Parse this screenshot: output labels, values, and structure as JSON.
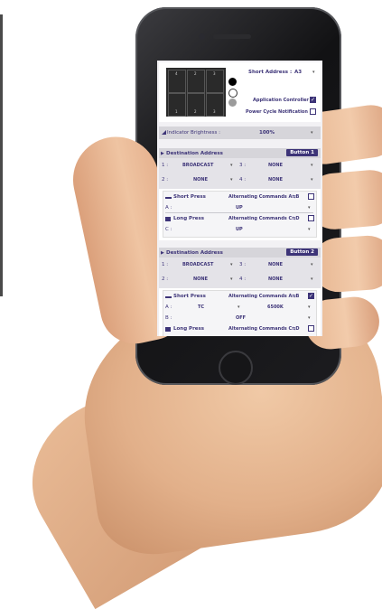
{
  "colors": {
    "accent": "#3d3478",
    "panel": "#d6d5da",
    "screen_bg": "#f2f1f4"
  },
  "top": {
    "grid_numbers": [
      "4",
      "2",
      "3",
      "1",
      "2",
      "3"
    ],
    "short_address_label": "Short Address :",
    "short_address_value": "A3",
    "application_controller_label": "Application Controller :",
    "power_cycle_label": "Power Cycle Notification :"
  },
  "brightness": {
    "label": "Indicator Brightness :",
    "value": "100%"
  },
  "button1": {
    "title": "Destination Address",
    "badge": "Button 1",
    "dest": [
      {
        "num": "1 :",
        "value": "BROADCAST"
      },
      {
        "num": "3 :",
        "value": "NONE"
      },
      {
        "num": "2 :",
        "value": "NONE"
      },
      {
        "num": "4 :",
        "value": "NONE"
      }
    ],
    "short_press": "Short Press",
    "alt_ab": "Alternating Commands A⇆B",
    "a_label": "A :",
    "a_value": "UP",
    "long_press": "Long Press",
    "alt_cd": "Alternating Commands C⇆D",
    "c_label": "C :",
    "c_value": "UP"
  },
  "button2": {
    "title": "Destination Address",
    "badge": "Button 2",
    "dest": [
      {
        "num": "1 :",
        "value": "BROADCAST"
      },
      {
        "num": "3 :",
        "value": "NONE"
      },
      {
        "num": "2 :",
        "value": "NONE"
      },
      {
        "num": "4 :",
        "value": "NONE"
      }
    ],
    "short_press": "Short Press",
    "alt_ab": "Alternating Commands A⇆B",
    "a_label": "A :",
    "a_value": "TC",
    "a_value2": "6500K",
    "b_label": "B :",
    "b_value": "OFF",
    "long_press": "Long Press",
    "alt_cd": "Alternating Commands C⇆D"
  }
}
